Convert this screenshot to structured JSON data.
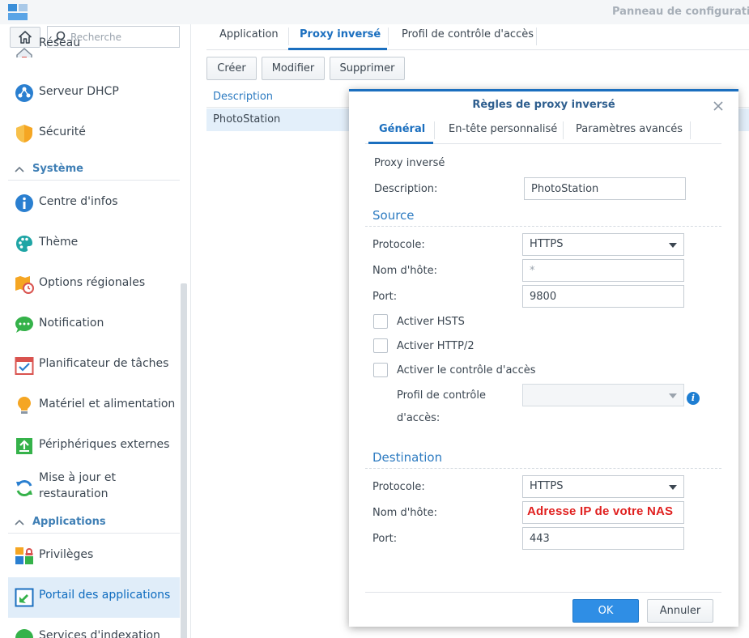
{
  "window": {
    "title": "Panneau de configurati"
  },
  "search": {
    "placeholder": "Recherche"
  },
  "sidebar": {
    "items": [
      {
        "label": "Réseau"
      },
      {
        "label": "Serveur DHCP"
      },
      {
        "label": "Sécurité"
      },
      {
        "label": "Centre d'infos"
      },
      {
        "label": "Thème"
      },
      {
        "label": "Options régionales"
      },
      {
        "label": "Notification"
      },
      {
        "label": "Planificateur de tâches"
      },
      {
        "label": "Matériel et alimentation"
      },
      {
        "label": "Périphériques externes"
      },
      {
        "label": "Mise à jour et restauration"
      },
      {
        "label": "Privilèges"
      },
      {
        "label": "Portail des applications"
      },
      {
        "label": "Services d'indexation"
      }
    ],
    "sections": {
      "system": "Système",
      "applications": "Applications"
    }
  },
  "main": {
    "tabs": [
      "Application",
      "Proxy inversé",
      "Profil de contrôle d'accès"
    ],
    "toolbar": {
      "create": "Créer",
      "edit": "Modifier",
      "delete": "Supprimer"
    },
    "grid": {
      "column_description": "Description",
      "rows": [
        "PhotoStation"
      ]
    }
  },
  "dialog": {
    "title": "Règles de proxy inversé",
    "tabs": [
      "Général",
      "En-tête personnalisé",
      "Paramètres avancés"
    ],
    "proxy_label": "Proxy inversé",
    "description_label": "Description:",
    "description_value": "PhotoStation",
    "source": {
      "title": "Source",
      "protocol_label": "Protocole:",
      "protocol_value": "HTTPS",
      "hostname_label": "Nom d'hôte:",
      "hostname_placeholder": "*",
      "port_label": "Port:",
      "port_value": "9800",
      "hsts_label": "Activer HSTS",
      "http2_label": "Activer HTTP/2",
      "access_control_label": "Activer le contrôle d'accès",
      "access_profile_label_1": "Profil de contrôle",
      "access_profile_label_2": "d'accès:"
    },
    "destination": {
      "title": "Destination",
      "protocol_label": "Protocole:",
      "protocol_value": "HTTPS",
      "hostname_label": "Nom d'hôte:",
      "hostname_value": "Adresse IP de votre NAS",
      "port_label": "Port:",
      "port_value": "443"
    },
    "buttons": {
      "ok": "OK",
      "cancel": "Annuler"
    }
  },
  "colors": {
    "accent": "#1b6fbf",
    "annotation": "#e0201f",
    "ok_button": "#2f8ee5"
  }
}
